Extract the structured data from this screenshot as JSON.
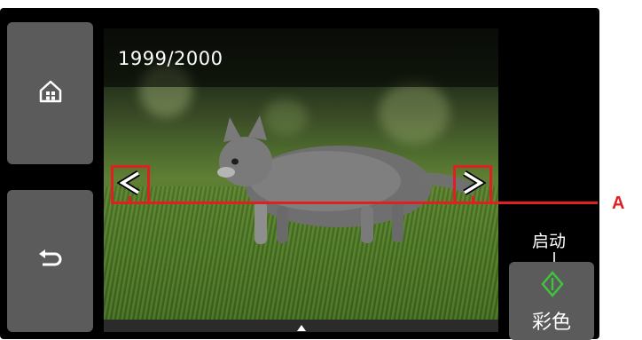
{
  "viewer": {
    "counter": "1999/2000"
  },
  "controls": {
    "start_label": "启动",
    "color_button_label": "彩色"
  },
  "annotation": {
    "label": "A",
    "color": "#e02020"
  },
  "icons": {
    "home": "home-icon",
    "back": "back-icon",
    "prev": "chevron-left-icon",
    "next": "chevron-right-icon",
    "start": "diamond-start-icon",
    "more": "triangle-up-icon"
  },
  "colors": {
    "panel_bg": "#000000",
    "button_bg": "#5b5b5b",
    "start_green": "#3ec43e",
    "callout_red": "#e02020"
  }
}
